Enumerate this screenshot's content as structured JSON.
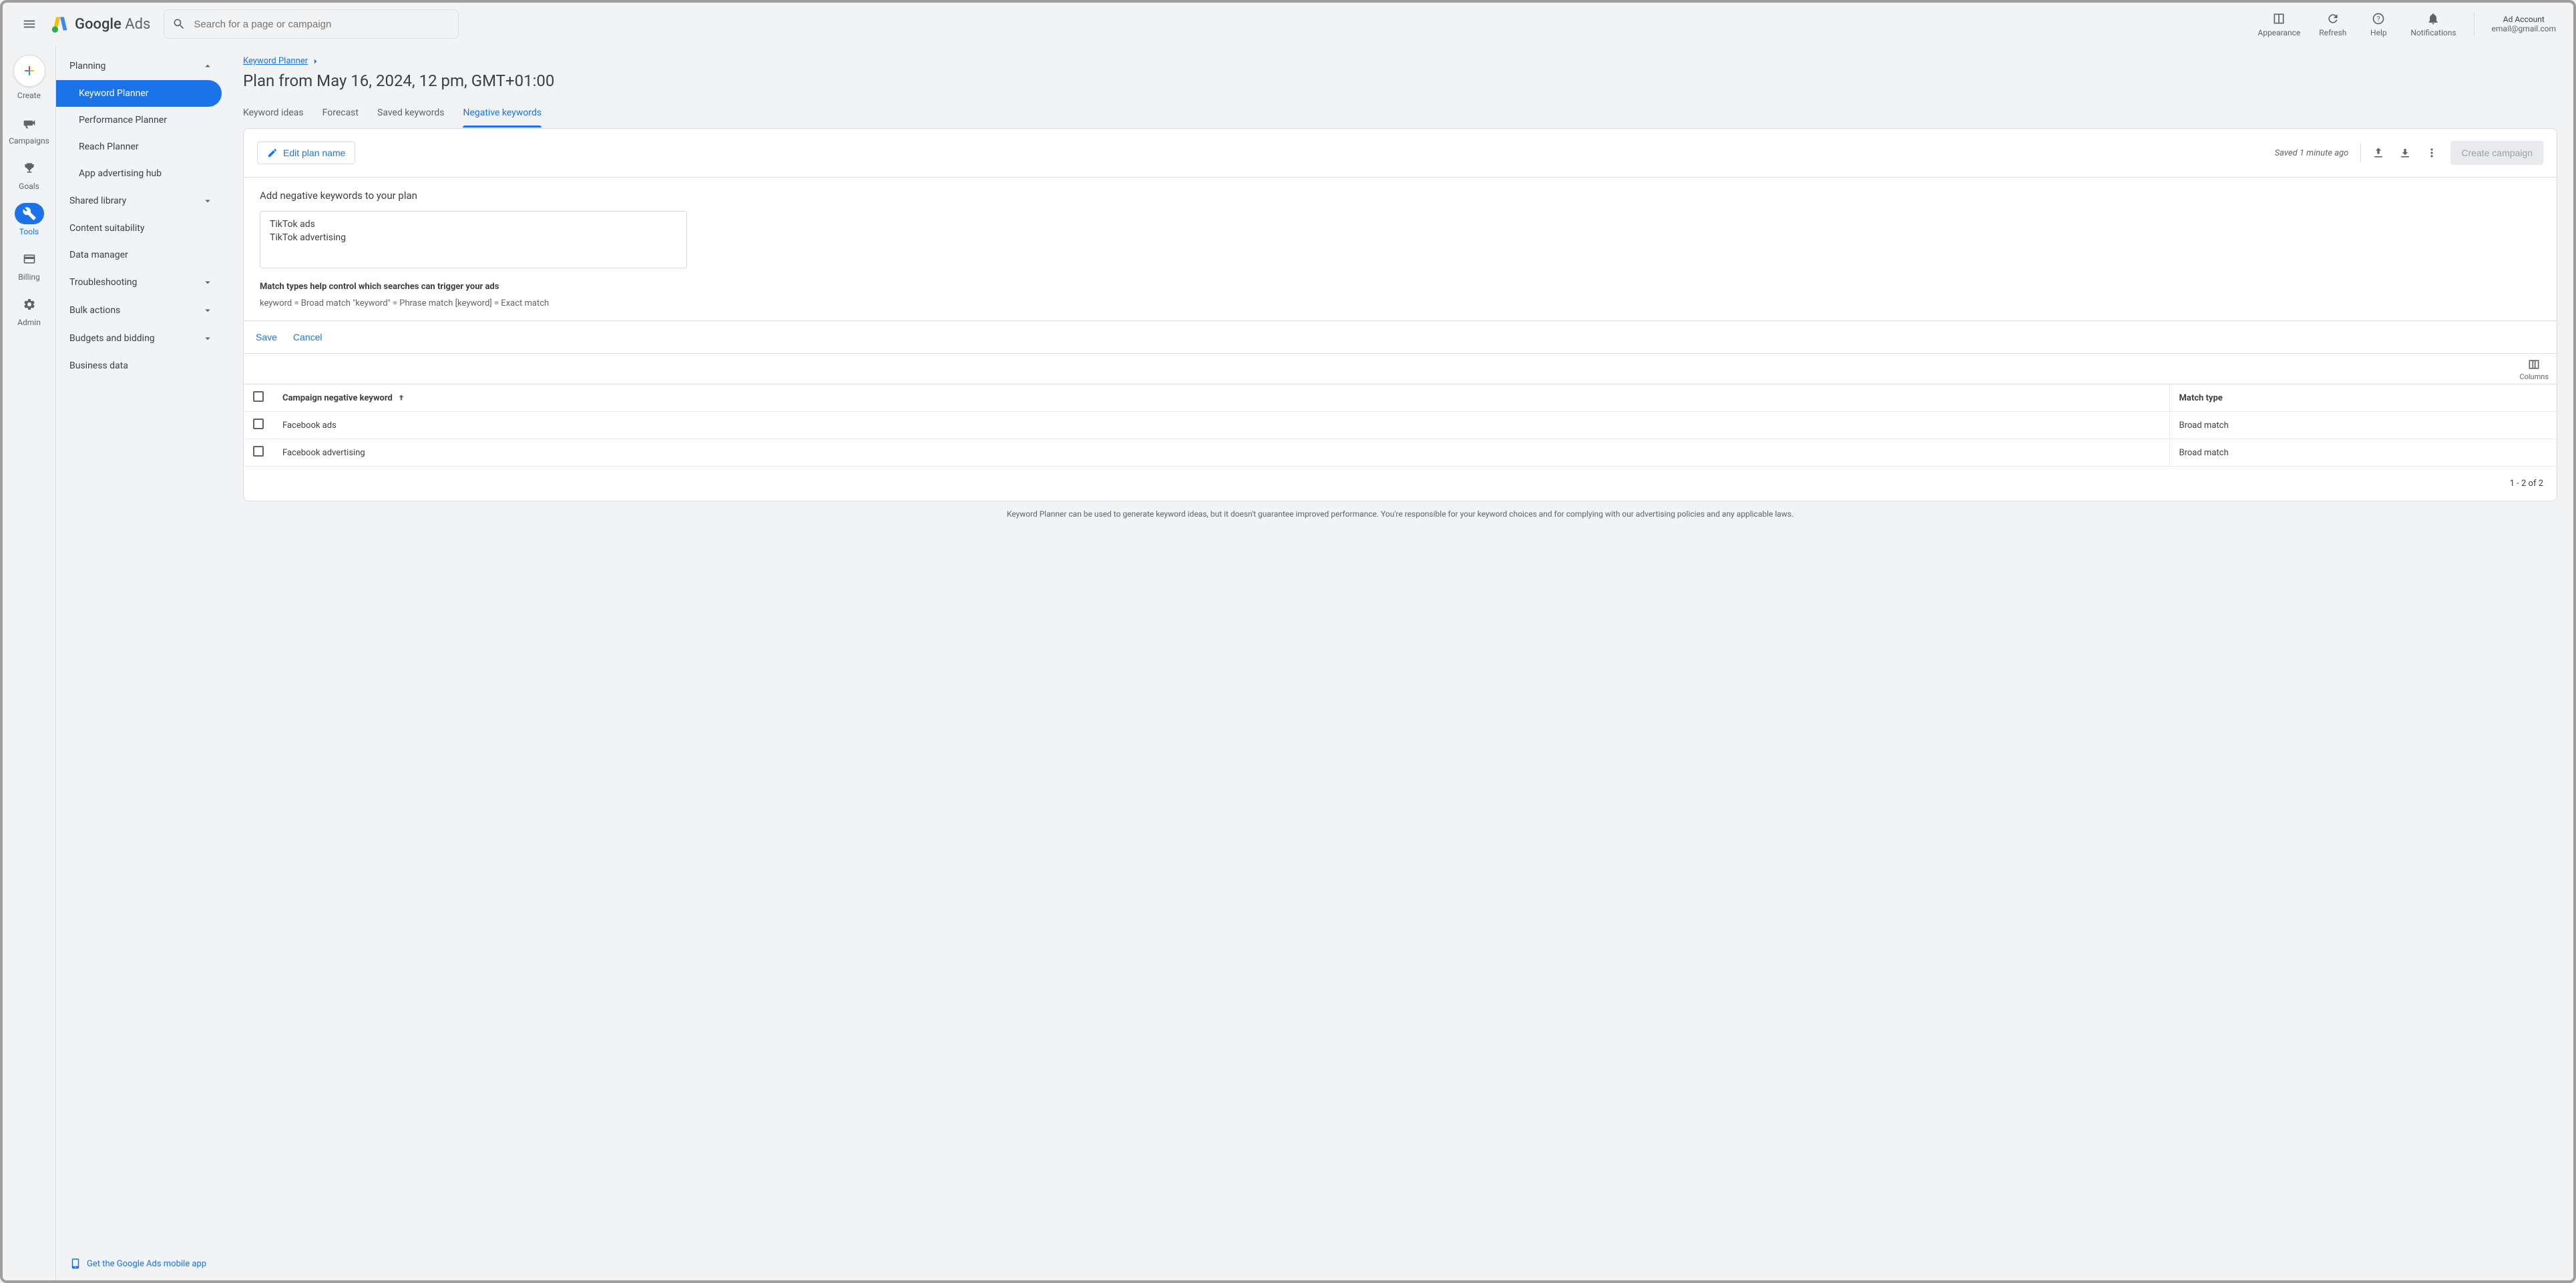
{
  "header": {
    "logo_text_regular": "Google ",
    "logo_text_light": "Ads",
    "search_placeholder": "Search for a page or campaign",
    "actions": {
      "appearance": "Appearance",
      "refresh": "Refresh",
      "help": "Help",
      "notifications": "Notifications"
    },
    "account": {
      "line1": "Ad Account",
      "line2": "email@gmail.com"
    }
  },
  "rail": {
    "create": "Create",
    "campaigns": "Campaigns",
    "goals": "Goals",
    "tools": "Tools",
    "billing": "Billing",
    "admin": "Admin"
  },
  "sidebar": {
    "groups": {
      "planning": "Planning",
      "shared_library": "Shared library",
      "troubleshooting": "Troubleshooting",
      "bulk_actions": "Bulk actions",
      "budgets_bidding": "Budgets and bidding"
    },
    "items": {
      "keyword_planner": "Keyword Planner",
      "performance_planner": "Performance Planner",
      "reach_planner": "Reach Planner",
      "app_hub": "App advertising hub",
      "content_suitability": "Content suitability",
      "data_manager": "Data manager",
      "business_data": "Business data"
    },
    "mobile_app": "Get the Google Ads mobile app"
  },
  "breadcrumb": "Keyword Planner",
  "page_title": "Plan from May 16, 2024, 12 pm, GMT+01:00",
  "tabs": {
    "keyword_ideas": "Keyword ideas",
    "forecast": "Forecast",
    "saved_keywords": "Saved keywords",
    "negative_keywords": "Negative keywords"
  },
  "toolbar": {
    "edit_plan": "Edit plan name",
    "saved": "Saved 1 minute ago",
    "create_campaign": "Create campaign"
  },
  "neg": {
    "title": "Add negative keywords to your plan",
    "textarea_value": "TikTok ads\nTikTok advertising",
    "hint": "Match types help control which searches can trigger your ads",
    "legend": "keyword = Broad match   \"keyword\" = Phrase match   [keyword] = Exact match",
    "save": "Save",
    "cancel": "Cancel"
  },
  "columns_label": "Columns",
  "table": {
    "headers": {
      "keyword": "Campaign negative keyword",
      "match": "Match type"
    },
    "rows": [
      {
        "keyword": "Facebook ads",
        "match": "Broad match"
      },
      {
        "keyword": "Facebook advertising",
        "match": "Broad match"
      }
    ],
    "footer": "1 - 2 of 2"
  },
  "disclaimer": "Keyword Planner can be used to generate keyword ideas, but it doesn't guarantee improved performance. You're responsible for your keyword choices and for complying with our advertising policies and any applicable laws."
}
